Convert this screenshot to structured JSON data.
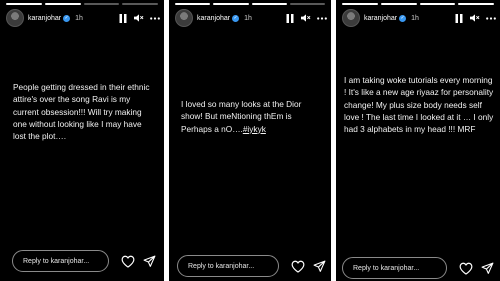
{
  "stories": [
    {
      "username": "karanjohar",
      "time": "1h",
      "text": "People getting dressed in their ethnic attire's over the song Ravi is my current obsession!!! Will try making one without looking like I may have lost the plot….",
      "reply_placeholder": "Reply to karanjohar..."
    },
    {
      "username": "karanjohar",
      "time": "1h",
      "text": "I loved so many looks at the Dior show! But meNtioning thEm is Perhaps a nO….",
      "hashtag": "#iykyk",
      "reply_placeholder": "Reply to karanjohar..."
    },
    {
      "username": "karanjohar",
      "time": "1h",
      "text": "I am taking woke tutorials every morning ! It's like a new age riyaaz for personality change! My plus size body needs self love ! The last time I looked at it … I only had 3 alphabets in my head !!! MRF",
      "reply_placeholder": "Reply to karanjohar..."
    }
  ],
  "icons": {
    "verified": "verified-badge-icon",
    "pause": "pause-icon",
    "mute": "mute-icon",
    "more": "more-icon",
    "like": "heart-icon",
    "share": "send-icon"
  },
  "colors": {
    "background": "#000000",
    "text": "#f2f2f2",
    "verified": "#3897f0"
  }
}
